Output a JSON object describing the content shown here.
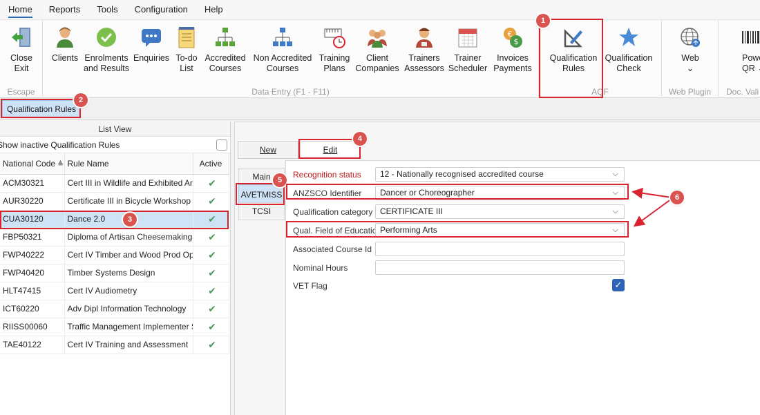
{
  "menu": {
    "items": [
      {
        "label": "Home"
      },
      {
        "label": "Reports"
      },
      {
        "label": "Tools"
      },
      {
        "label": "Configuration"
      },
      {
        "label": "Help"
      }
    ]
  },
  "ribbon": {
    "groups": {
      "escape": "Escape",
      "data_entry": "Data Entry (F1 - F11)",
      "aqf": "AQF",
      "web_plugin": "Web Plugin",
      "doc_vali": "Doc. Vali"
    },
    "buttons": {
      "close_exit": "Close\nExit",
      "clients": "Clients",
      "enrolments": "Enrolments\nand Results",
      "enquiries": "Enquiries",
      "todo": "To-do\nList",
      "accredited": "Accredited\nCourses",
      "non_accredited": "Non Accredited\nCourses",
      "training_plans": "Training\nPlans",
      "client_companies": "Client\nCompanies",
      "trainers_assessors": "Trainers\nAssessors",
      "trainer_scheduler": "Trainer\nScheduler",
      "invoices_payments": "Invoices\nPayments",
      "qualification_rules": "Qualification\nRules",
      "qualification_check": "Qualification\nCheck",
      "web": "Web\n⌄",
      "power_qr": "Powe\nQR ⌄"
    }
  },
  "doc_tab": {
    "label": "Qualification Rules"
  },
  "list_view": {
    "header": "List View",
    "show_inactive": "Show inactive Qualification Rules",
    "columns": [
      "National Code",
      "Rule Name",
      "Active"
    ],
    "rows": [
      {
        "code": "ACM30321",
        "name": "Cert III in Wildlife and Exhibited Animal Care",
        "active": "✔"
      },
      {
        "code": "AUR30220",
        "name": "Certificate III in Bicycle Workshop Operations",
        "active": "✔"
      },
      {
        "code": "CUA30120",
        "name": "Dance 2.0",
        "active": "✔"
      },
      {
        "code": "FBP50321",
        "name": "Diploma of Artisan Cheesemaking",
        "active": "✔"
      },
      {
        "code": "FWP40222",
        "name": "Cert IV Timber and Wood Prod Operations",
        "active": "✔"
      },
      {
        "code": "FWP40420",
        "name": "Timber Systems Design",
        "active": "✔"
      },
      {
        "code": "HLT47415",
        "name": "Cert IV Audiometry",
        "active": "✔"
      },
      {
        "code": "ICT60220",
        "name": "Adv Dipl Information Technology",
        "active": "✔"
      },
      {
        "code": "RIISS00060",
        "name": "Traffic Management Implementer Skill Set",
        "active": "✔"
      },
      {
        "code": "TAE40122",
        "name": "Cert IV Training and Assessment",
        "active": "✔"
      }
    ]
  },
  "edit_panel": {
    "new_label": "New",
    "edit_label": "Edit",
    "tabs": [
      "Main",
      "AVETMISS",
      "TCSI"
    ],
    "fields": {
      "recognition_status": {
        "label": "Recognition status",
        "value": "12 - Nationally recognised accredited course"
      },
      "anzsco": {
        "label": "ANZSCO Identifier",
        "value": "Dancer or Choreographer"
      },
      "qual_category": {
        "label": "Qualification category",
        "value": "CERTIFICATE III"
      },
      "field_of_education": {
        "label": "Qual. Field of Education",
        "value": "Performing Arts"
      },
      "associated_course_id": {
        "label": "Associated Course Id",
        "value": ""
      },
      "nominal_hours": {
        "label": "Nominal Hours",
        "value": ""
      },
      "vet_flag": {
        "label": "VET Flag",
        "checked": true
      }
    }
  },
  "annotations": [
    "1",
    "2",
    "3",
    "4",
    "5",
    "6"
  ],
  "colors": {
    "accent": "#2a6ebd",
    "selection": "#cfe3f7",
    "highlight": "#d9232e",
    "badge": "#d9534f",
    "required_label": "#c21818"
  }
}
